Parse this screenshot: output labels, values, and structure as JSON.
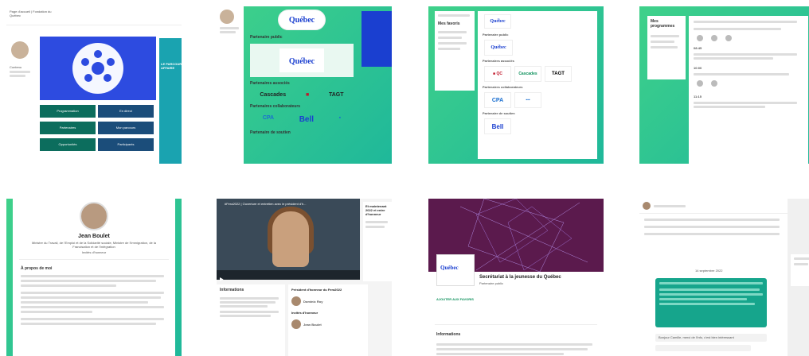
{
  "tile1": {
    "topnav_title": "Page d'accueil | Fondation du Québec",
    "left_label": "Contenu",
    "grid": [
      "Programmation",
      "En direct",
      "Partenaires",
      "Mon parcours",
      "Opportunités",
      "Participants"
    ],
    "right_text": "LE PARCOURS\nAFFAIRE"
  },
  "tile2": {
    "sections": [
      "Partenaire public",
      "Partenaires associés",
      "Partenaires collaborateurs",
      "Partenaire de soutien"
    ],
    "logos": [
      "Québec",
      "Cascades",
      "TAGT",
      "CPA",
      "Bell"
    ]
  },
  "tile3": {
    "panel_title": "Mes favoris",
    "main_sections": [
      "Partenaire public",
      "Partenaires associés",
      "Partenaires collaborateurs",
      "Partenaire de soutien"
    ],
    "logos": [
      "Québec",
      "Cascades",
      "TAGT",
      "CPA",
      "Bell"
    ]
  },
  "tile4": {
    "panel_title": "Mes programmes",
    "rows": [
      "08:45",
      "10:00",
      "11:15"
    ]
  },
  "tile5": {
    "name": "Jean Boulet",
    "role": "Ministre du Travail, de l'Emploi et de la Solidarité sociale, Ministre de l'Immigration, de la Francisation et de l'Intégration",
    "guest": "Invités d'honneur",
    "about_title": "À propos de moi"
  },
  "tile6": {
    "video_title": "#Fera2022 | Ouverture et entretien avec le président d'h...",
    "info_title": "Informations",
    "pres_title": "Président d'honneur du Fera2022",
    "pres_name": "Dominic Roy",
    "guests_title": "Invités d'honneur",
    "guest_name": "Jean Boulet",
    "side_title": "Et maintenant 2022 et entre d'honneur"
  },
  "tile7": {
    "title": "Secrétariat à la jeunesse du Québec",
    "subtitle": "Partenaire public",
    "button": "AJOUTER AUX FAVORIS",
    "info": "Informations"
  },
  "tile8": {
    "date": "14 septembre 2022",
    "reply": "Bonjour Camille, merci de l'info, c'est bien intéressant"
  }
}
